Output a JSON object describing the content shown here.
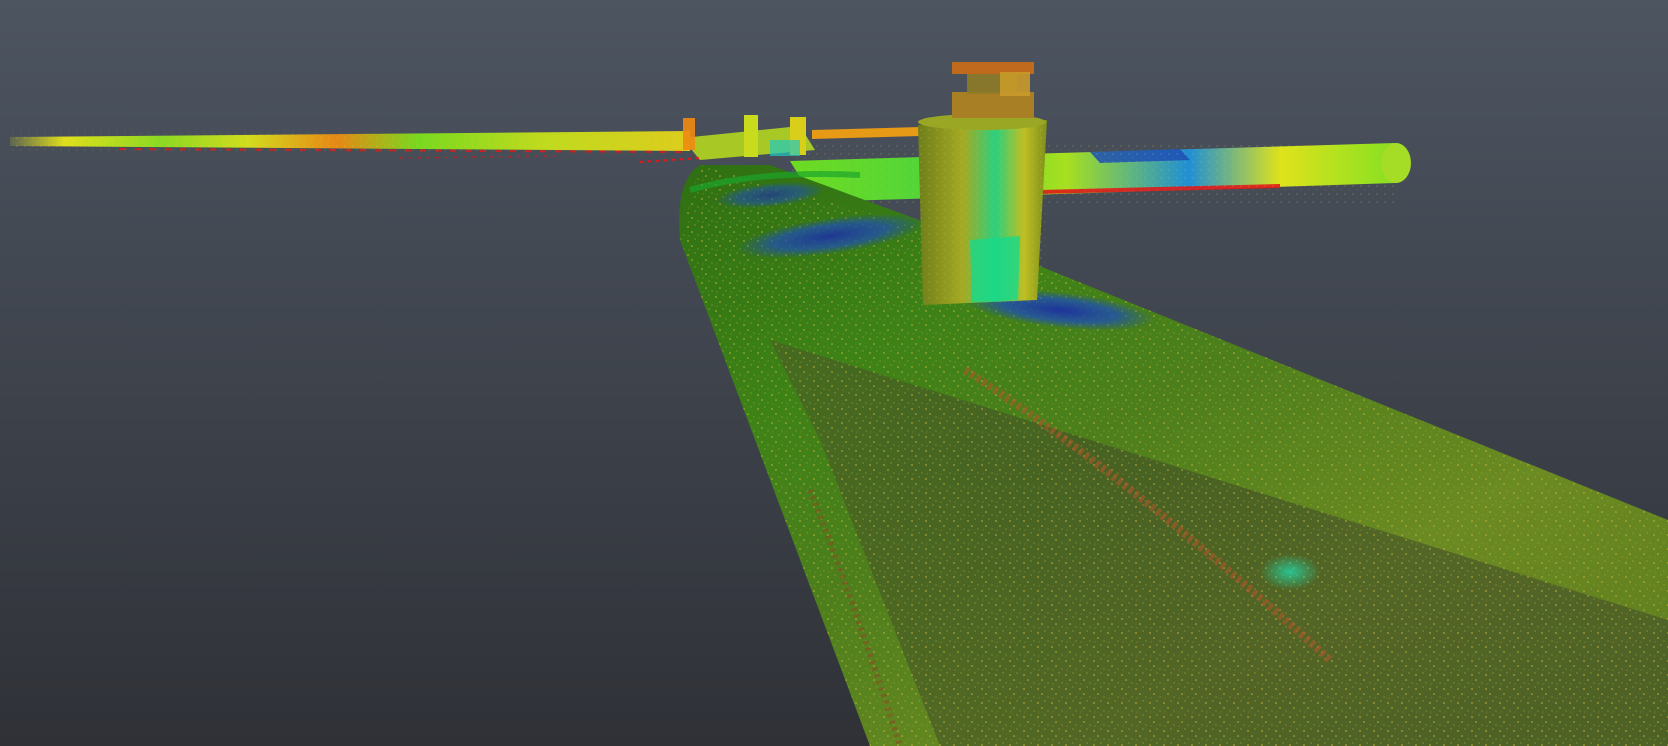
{
  "viewer": {
    "background_top": "#4d5561",
    "background_bottom": "#2f3137"
  },
  "scan_colormap": [
    "#0a1f8c",
    "#1760c8",
    "#16c8b8",
    "#18c93a",
    "#7be01c",
    "#e8e619",
    "#f08a12",
    "#e01a1a"
  ],
  "objects": [
    {
      "name": "main-pipe",
      "dominant_colors": [
        "#3f7d16",
        "#6c8a1d",
        "#1d3fa3"
      ]
    },
    {
      "name": "horizontal-pipe-left",
      "dominant_colors": [
        "#8fe020",
        "#e8e619",
        "#f08a12"
      ]
    },
    {
      "name": "horizontal-pipe-right",
      "dominant_colors": [
        "#55d62a",
        "#1b6fd0",
        "#e01a1a"
      ]
    },
    {
      "name": "vertical-riser",
      "dominant_colors": [
        "#a6a826",
        "#1fcf8a",
        "#c48a22"
      ]
    },
    {
      "name": "pipe-support-bracket",
      "dominant_colors": [
        "#b7d81f",
        "#e9c21b"
      ]
    }
  ]
}
